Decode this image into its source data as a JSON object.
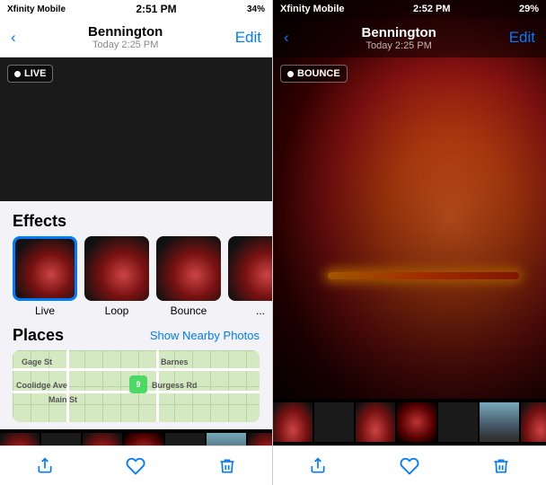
{
  "left": {
    "statusBar": {
      "carrier": "Xfinity Mobile",
      "time": "2:51 PM",
      "battery": "34%"
    },
    "navBar": {
      "backLabel": "‹",
      "title": "Bennington",
      "subtitle": "Today 2:25 PM",
      "editLabel": "Edit"
    },
    "liveBadge": "LIVE",
    "sections": {
      "effects": {
        "header": "Effects",
        "items": [
          {
            "label": "Live",
            "selected": true
          },
          {
            "label": "Loop",
            "selected": false
          },
          {
            "label": "Bounce",
            "selected": false
          },
          {
            "label": "...",
            "selected": false
          }
        ]
      },
      "places": {
        "header": "Places",
        "showNearbyLabel": "Show Nearby Photos",
        "mapPin": "9",
        "mapLabels": [
          "Gage St",
          "Coolidge Ave",
          "Main St",
          "Barnes",
          "Burgess Rd"
        ]
      }
    },
    "toolbar": {
      "shareIcon": "share",
      "heartIcon": "♡",
      "trashIcon": "trash"
    }
  },
  "right": {
    "statusBar": {
      "carrier": "Xfinity Mobile",
      "time": "2:52 PM",
      "battery": "29%"
    },
    "navBar": {
      "backLabel": "‹",
      "title": "Bennington",
      "subtitle": "Today 2:25 PM",
      "editLabel": "Edit"
    },
    "bounceBadge": "BOUNCE",
    "toolbar": {
      "shareIcon": "share",
      "heartIcon": "♡",
      "trashIcon": "trash"
    }
  }
}
